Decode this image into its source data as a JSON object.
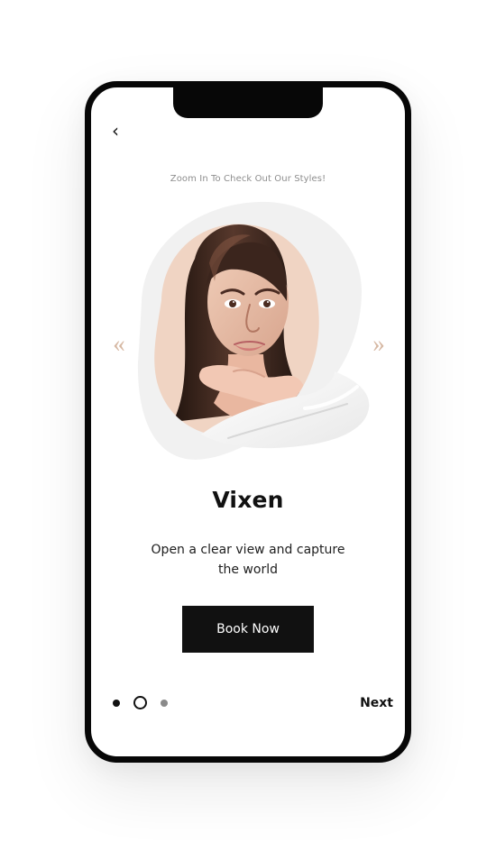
{
  "screen": {
    "back_icon_glyph": "‹",
    "helper_text": "Zoom In To Check Out Our Styles!",
    "previous_arrow": "«",
    "next_arrow": "»",
    "title": "Vixen",
    "description": "Open a clear view and capture the world",
    "primary_button": "Book Now",
    "next_label": "Next"
  },
  "carousel": {
    "current_page": 2,
    "page_count": 3,
    "image_subject": "portrait-of-woman",
    "arrow_color": "#d6b8a3"
  },
  "icons": {
    "back": "chevron-left-icon",
    "previous": "double-chevron-left-icon",
    "next": "double-chevron-right-icon"
  }
}
